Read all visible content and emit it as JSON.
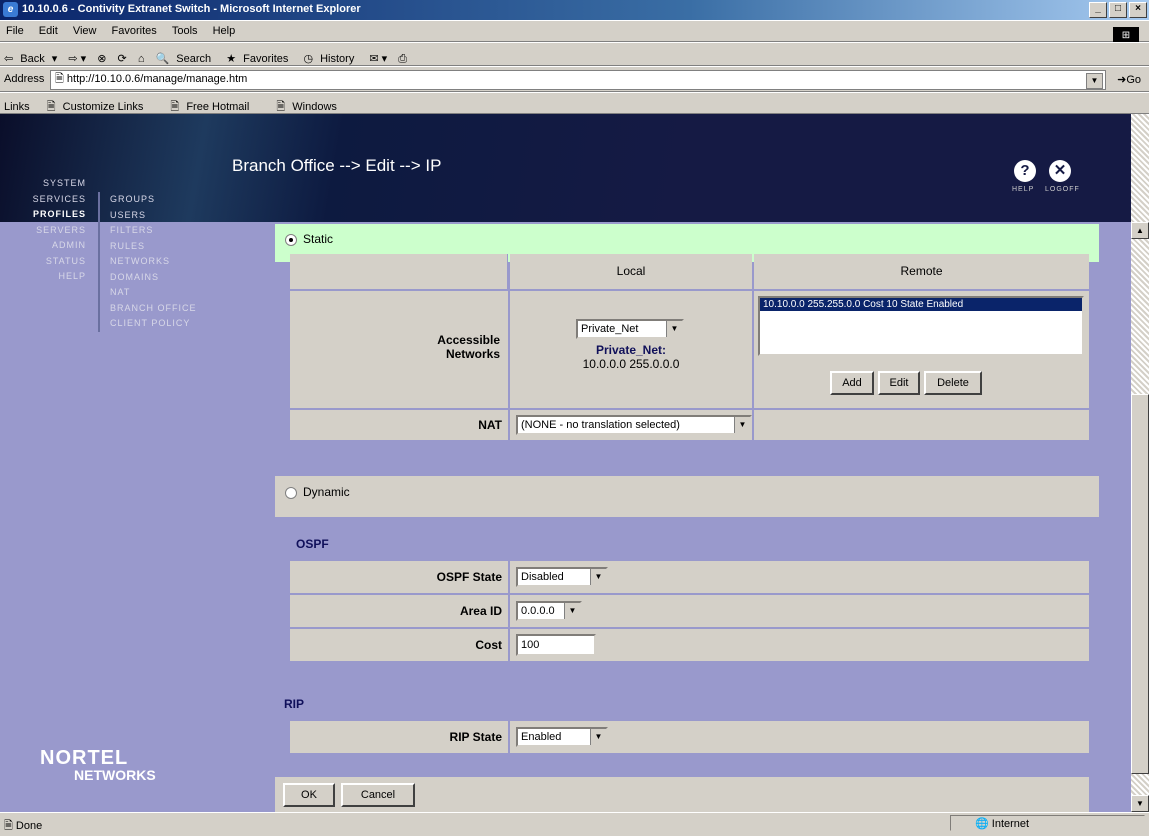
{
  "window": {
    "title": "10.10.0.6 - Contivity Extranet Switch - Microsoft Internet Explorer"
  },
  "menu": [
    "File",
    "Edit",
    "View",
    "Favorites",
    "Tools",
    "Help"
  ],
  "toolbar": {
    "back": "Back",
    "search": "Search",
    "favorites": "Favorites",
    "history": "History"
  },
  "address": {
    "label": "Address",
    "url": "http://10.10.0.6/manage/manage.htm",
    "go": "Go"
  },
  "links": {
    "label": "Links",
    "items": [
      "Customize Links",
      "Free Hotmail",
      "Windows"
    ]
  },
  "header": {
    "title": "Branch Office --> Edit --> IP",
    "help": "HELP",
    "logoff": "LOGOFF"
  },
  "nav": {
    "main": [
      "SYSTEM",
      "SERVICES",
      "PROFILES",
      "SERVERS",
      "ADMIN",
      "STATUS",
      "HELP"
    ],
    "sub": [
      "GROUPS",
      "USERS",
      "FILTERS",
      "RULES",
      "NETWORKS",
      "DOMAINS",
      "NAT",
      "BRANCH OFFICE",
      "CLIENT POLICY"
    ]
  },
  "logo": {
    "line1": "NORTEL",
    "line2": "NETWORKS"
  },
  "static": {
    "label": "Static",
    "col_local": "Local",
    "col_remote": "Remote",
    "accessible_label_1": "Accessible",
    "accessible_label_2": "Networks",
    "local_select": "Private_Net",
    "local_net_name": "Private_Net:",
    "local_net_addr": "10.0.0.0 255.0.0.0",
    "remote_entry": "10.10.0.0 255.255.0.0 Cost 10 State Enabled",
    "add": "Add",
    "edit": "Edit",
    "delete": "Delete",
    "nat_label": "NAT",
    "nat_value": "(NONE - no translation selected)"
  },
  "dynamic": {
    "label": "Dynamic"
  },
  "ospf": {
    "heading": "OSPF",
    "state_label": "OSPF State",
    "state_value": "Disabled",
    "area_label": "Area ID",
    "area_value": "0.0.0.0",
    "cost_label": "Cost",
    "cost_value": "100"
  },
  "rip": {
    "heading": "RIP",
    "state_label": "RIP State",
    "state_value": "Enabled"
  },
  "actions": {
    "ok": "OK",
    "cancel": "Cancel"
  },
  "status": {
    "left": "Done",
    "zone": "Internet"
  }
}
